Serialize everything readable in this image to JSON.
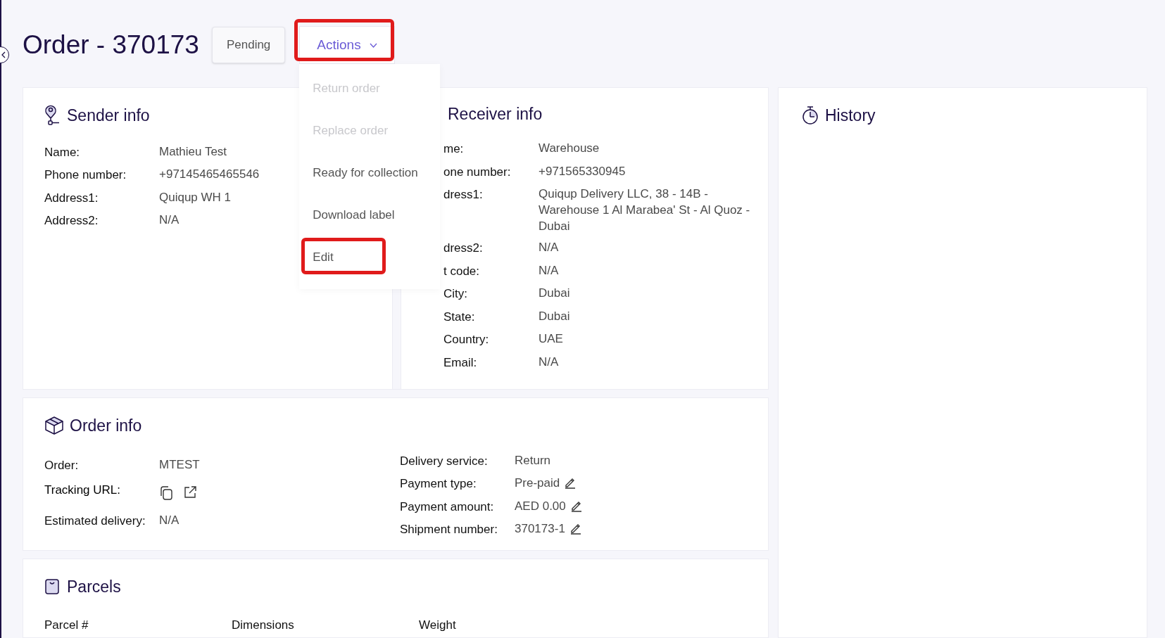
{
  "title": "Order - 370173",
  "status": "Pending",
  "actions": {
    "label": "Actions",
    "highlighted": true,
    "menu": [
      {
        "label": "Return order",
        "disabled": true,
        "highlighted": false
      },
      {
        "label": "Replace order",
        "disabled": true,
        "highlighted": false
      },
      {
        "label": "Ready for collection",
        "disabled": false,
        "highlighted": false
      },
      {
        "label": "Download label",
        "disabled": false,
        "highlighted": false
      },
      {
        "label": "Edit",
        "disabled": false,
        "highlighted": true
      }
    ]
  },
  "sender": {
    "title": "Sender info",
    "rows": [
      {
        "label": "Name:",
        "value": "Mathieu Test"
      },
      {
        "label": "Phone number:",
        "value": "+97145465465546"
      },
      {
        "label": "Address1:",
        "value": "Quiqup WH 1"
      },
      {
        "label": "Address2:",
        "value": "N/A"
      }
    ]
  },
  "receiver": {
    "title": "Receiver info",
    "rows": [
      {
        "label": "me:",
        "value": "Warehouse"
      },
      {
        "label": "one number:",
        "value": "+971565330945"
      },
      {
        "label": "dress1:",
        "value": "Quiqup Delivery LLC, 38 - 14B - Warehouse 1 Al Marabea' St - Al Quoz - Dubai"
      },
      {
        "label": "dress2:",
        "value": "N/A"
      },
      {
        "label": "t code:",
        "value": "N/A"
      },
      {
        "label": "City:",
        "value": "Dubai"
      },
      {
        "label": "State:",
        "value": "Dubai"
      },
      {
        "label": "Country:",
        "value": "UAE"
      },
      {
        "label": "Email:",
        "value": "N/A"
      }
    ]
  },
  "order_info": {
    "title": "Order info",
    "left": [
      {
        "kind": "text",
        "label": "Order:",
        "value": "MTEST"
      },
      {
        "kind": "links",
        "label": "Tracking URL:"
      },
      {
        "kind": "text",
        "label": "Estimated delivery:",
        "value": "N/A"
      }
    ],
    "right": [
      {
        "label": "Delivery service:",
        "value": "Return",
        "editable": false
      },
      {
        "label": "Payment type:",
        "value": "Pre-paid",
        "editable": true
      },
      {
        "label": "Payment amount:",
        "value": "AED 0.00",
        "editable": true
      },
      {
        "label": "Shipment number:",
        "value": "370173-1",
        "editable": true
      }
    ]
  },
  "parcels": {
    "title": "Parcels",
    "columns": [
      "Parcel #",
      "Dimensions",
      "Weight"
    ]
  },
  "history": {
    "title": "History"
  }
}
